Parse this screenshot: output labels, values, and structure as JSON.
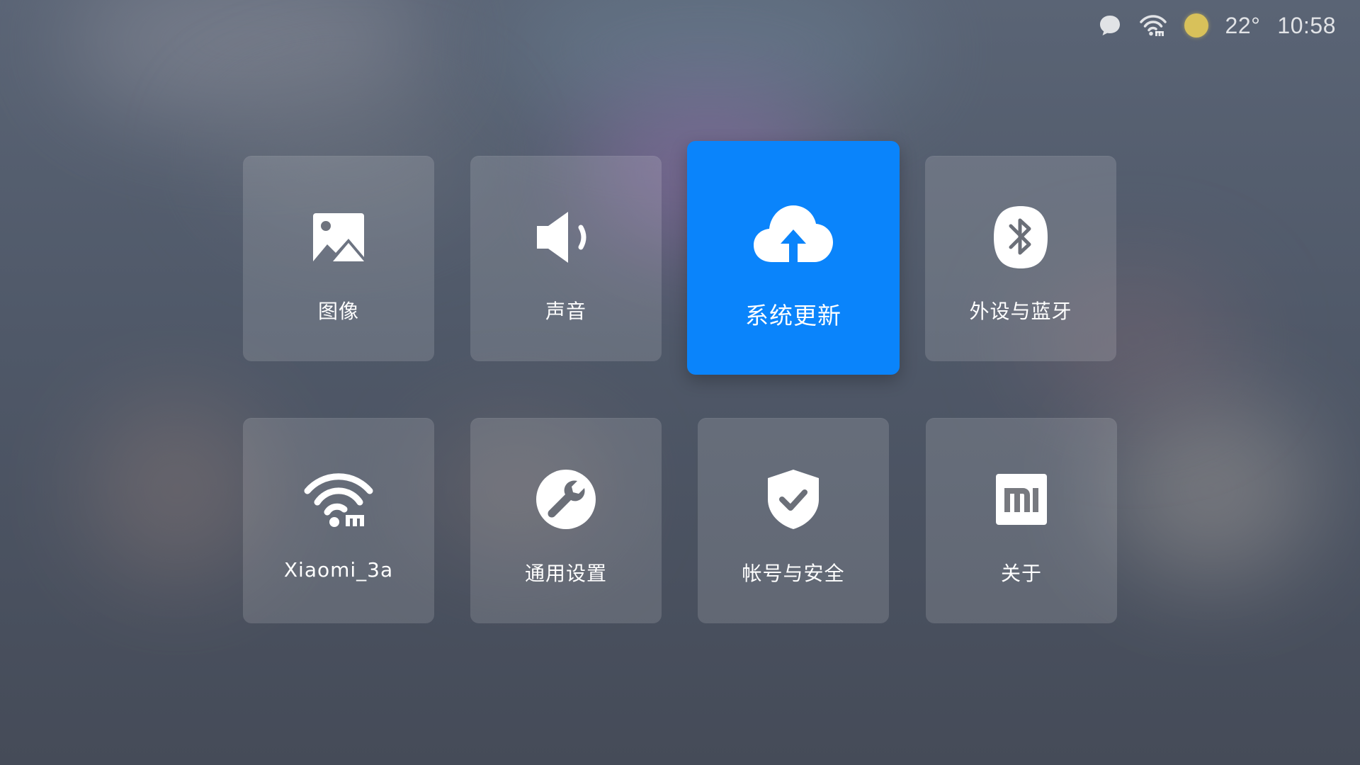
{
  "status_bar": {
    "icons": [
      "message-icon",
      "wifi-mi-icon",
      "weather-sun-icon"
    ],
    "temperature": "22°",
    "time": "10:58",
    "weather_color": "#d8c15a"
  },
  "menu": {
    "focused_index": 2,
    "focus_color": "#0a84fb",
    "items": [
      {
        "label": "图像",
        "icon": "picture-icon"
      },
      {
        "label": "声音",
        "icon": "speaker-icon"
      },
      {
        "label": "系统更新",
        "icon": "cloud-upload-icon"
      },
      {
        "label": "外设与蓝牙",
        "icon": "bluetooth-icon"
      },
      {
        "label": "Xiaomi_3a",
        "icon": "wifi-mi-icon"
      },
      {
        "label": "通用设置",
        "icon": "wrench-icon"
      },
      {
        "label": "帐号与安全",
        "icon": "shield-check-icon"
      },
      {
        "label": "关于",
        "icon": "mi-logo-icon"
      }
    ]
  }
}
